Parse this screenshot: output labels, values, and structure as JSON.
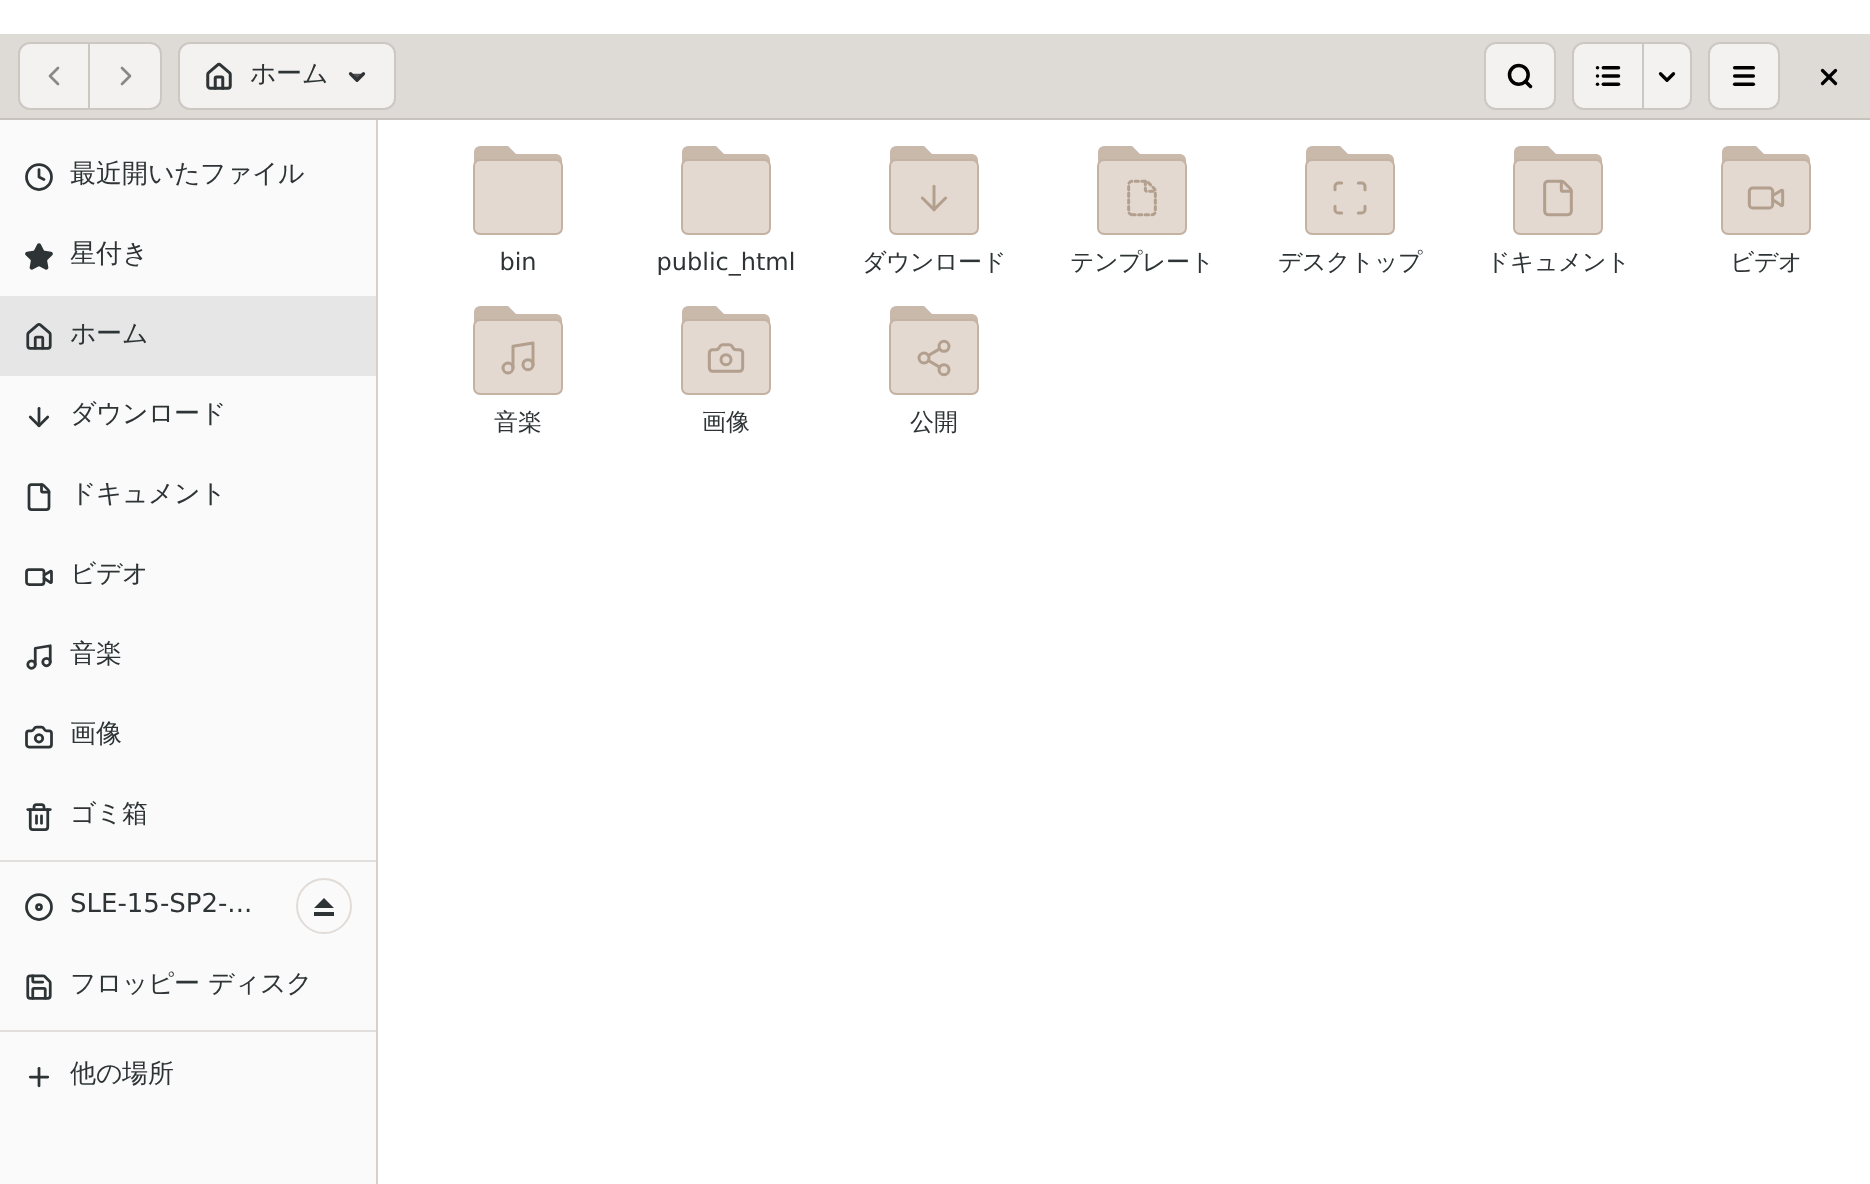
{
  "header": {
    "location": "ホーム"
  },
  "sidebar": {
    "items": [
      {
        "kind": "recent",
        "label": "最近開いたファイル",
        "selected": false
      },
      {
        "kind": "starred",
        "label": "星付き",
        "selected": false
      },
      {
        "kind": "home",
        "label": "ホーム",
        "selected": true
      },
      {
        "kind": "download",
        "label": "ダウンロード",
        "selected": false
      },
      {
        "kind": "document",
        "label": "ドキュメント",
        "selected": false
      },
      {
        "kind": "video",
        "label": "ビデオ",
        "selected": false
      },
      {
        "kind": "music",
        "label": "音楽",
        "selected": false
      },
      {
        "kind": "picture",
        "label": "画像",
        "selected": false
      },
      {
        "kind": "trash",
        "label": "ゴミ箱",
        "selected": false
      },
      {
        "kind": "disc",
        "label": "SLE-15-SP2-...",
        "selected": false,
        "ejectable": true
      },
      {
        "kind": "floppy",
        "label": "フロッピー ディスク",
        "selected": false
      },
      {
        "kind": "other",
        "label": "他の場所",
        "selected": false
      }
    ]
  },
  "files": [
    {
      "kind": "plain",
      "name": "bin"
    },
    {
      "kind": "plain",
      "name": "public_html"
    },
    {
      "kind": "download",
      "name": "ダウンロード"
    },
    {
      "kind": "template",
      "name": "テンプレート"
    },
    {
      "kind": "desktop",
      "name": "デスクトップ"
    },
    {
      "kind": "document",
      "name": "ドキュメント"
    },
    {
      "kind": "video",
      "name": "ビデオ"
    },
    {
      "kind": "music",
      "name": "音楽"
    },
    {
      "kind": "picture",
      "name": "画像"
    },
    {
      "kind": "share",
      "name": "公開"
    }
  ]
}
